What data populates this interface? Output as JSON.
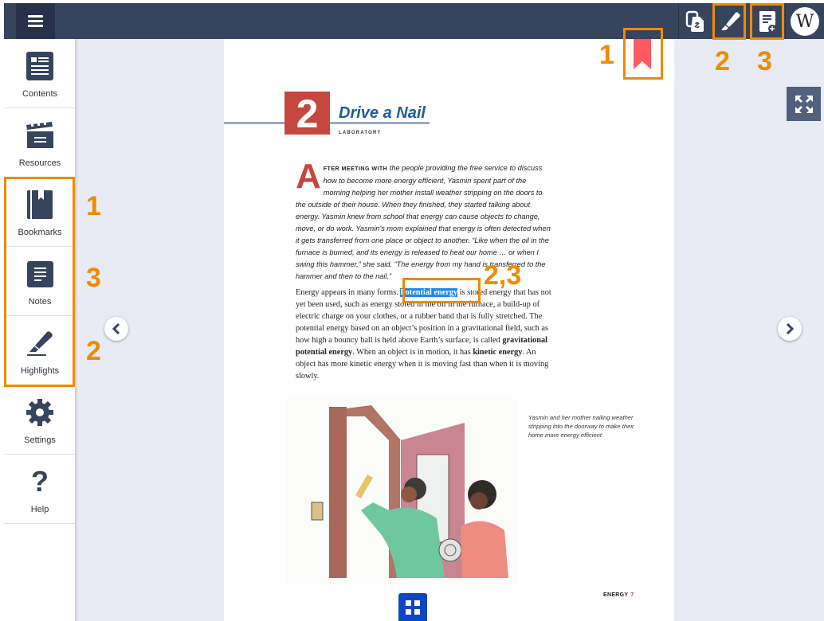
{
  "topbar": {
    "menu_icon": "hamburger-icon",
    "buttons": [
      {
        "name": "copy-link",
        "icon": "copy-link-icon"
      },
      {
        "name": "highlight",
        "icon": "highlighter-icon"
      },
      {
        "name": "add-note",
        "icon": "note-add-icon"
      }
    ],
    "wiki_label": "W"
  },
  "sidebar": {
    "items": [
      {
        "label": "Contents",
        "icon": "contents-icon"
      },
      {
        "label": "Resources",
        "icon": "clapperboard-icon"
      },
      {
        "label": "Bookmarks",
        "icon": "bookmark-book-icon"
      },
      {
        "label": "Notes",
        "icon": "notes-icon"
      },
      {
        "label": "Highlights",
        "icon": "highlighter-icon"
      },
      {
        "label": "Settings",
        "icon": "gear-icon"
      },
      {
        "label": "Help",
        "icon": "question-icon"
      }
    ]
  },
  "page": {
    "chapter_number": "2",
    "chapter_title": "Drive a Nail",
    "chapter_subtitle": "LABORATORY",
    "intro": {
      "dropcap": "A",
      "smallcaps": "FTER MEETING WITH",
      "text": " the people providing the free service to discuss how to become more energy efficient, Yasmin spent part of the morning helping her mother install weather stripping on the doors to the outside of their house. When they finished, they started talking about energy. Yasmin knew from school that energy can cause objects to change, move, or do work. Yasmin’s mom explained that energy is often detected when it gets transferred from one place or object to another. “Like when the oil in the furnace is burned, and its energy is released to heat our home … or when I swing this hammer,” she said. “The energy from my hand is transferred to the hammer and then to the nail.”"
    },
    "body": {
      "p1": "Energy appears in many forms. ",
      "highlight": "Potential energy",
      "p2": " is stored energy that has not yet been used, such as energy stored in the oil in the furnace, a build-up of electric charge on your clothes, or a rubber band that is fully stretched. The potential energy based on an object’s position in a gravitational field, such as how high a bouncy ball is held above Earth’s surface, is called ",
      "bold1": "gravitational potential energy",
      "p3": ". When an object is in motion, it has ",
      "bold2": "kinetic energy",
      "p4": ". An object has more kinetic energy when it is moving fast than when it is moving slowly."
    },
    "illustration_alt": "Yasmin and her mother nailing weather stripping into a doorway",
    "caption": "Yasmin and her mother nailing weather stripping into the doorway to make their home more energy efficient",
    "footer_section": "ENERGY",
    "footer_page": "7"
  },
  "colors": {
    "topbar": "#37445d",
    "accent_red": "#c5473f",
    "bookmark": "#ff5a5f",
    "highlight": "#1e88e5",
    "annotation": "#f08a00"
  },
  "annotations": {
    "bookmark": "1",
    "highlight": "2",
    "note": "3",
    "text_selection": "2,3"
  }
}
